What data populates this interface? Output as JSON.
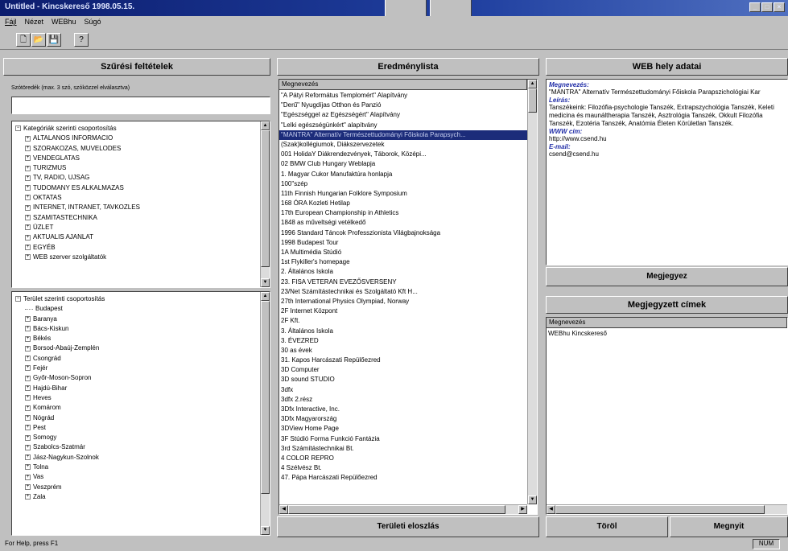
{
  "window": {
    "title": "Untitled - Kincskereső 1998.05.15."
  },
  "menu": [
    "Fájl",
    "Nézet",
    "WEBhu",
    "Súgó"
  ],
  "toolbar": {
    "icons": [
      "new-icon",
      "open-icon",
      "save-icon",
      "help-icon"
    ]
  },
  "filter_panel": {
    "header": "Szűrési feltételek",
    "word_label": "Szótöredék (max. 3 szó, szóközzel elválasztva)",
    "word_value": "",
    "category_root": "Kategóriák szerinti csoportosítás",
    "categories": [
      "ALTALANOS INFORMACIO",
      "SZORAKOZAS, MUVELODES",
      "VENDEGLATAS",
      "TURIZMUS",
      "TV, RADIO, UJSAG",
      "TUDOMANY ES ALKALMAZAS",
      "OKTATAS",
      "INTERNET, INTRANET, TAVKOZLES",
      "SZAMITASTECHNIKA",
      "ÜZLET",
      "AKTUALIS AJANLAT",
      "EGYÉB",
      "WEB szerver szolgáltatók"
    ],
    "region_root": "Terület szerinti csoportosítás",
    "regions": [
      "Budapest",
      "Baranya",
      "Bács-Kiskun",
      "Békés",
      "Borsod-Abaúj-Zemplén",
      "Csongrád",
      "Fejér",
      "Győr-Moson-Sopron",
      "Hajdú-Bihar",
      "Heves",
      "Komárom",
      "Nógrád",
      "Pest",
      "Somogy",
      "Szabolcs-Szatmár",
      "Jász-Nagykun-Szolnok",
      "Tolna",
      "Vas",
      "Veszprém",
      "Zala"
    ]
  },
  "results_panel": {
    "header": "Eredménylista",
    "column": "Megnevezés",
    "rows": [
      "\"A Pátyi Református Templomért\" Alapítvány",
      "\"Derű\" Nyugdíjas Otthon és Panzió",
      "\"Egészséggel az Egészségért\" Alapítvány",
      "\"Lelki egészségünkért\" alapítvány",
      "\"MANTRA\" Alternatív Természettudományi Főiskola Parapsych...",
      "(Szak)kollégiumok, Diákszervezetek",
      "001 HolidaY Diákrendezvények, Táborok, Középi...",
      "02 BMW Club Hungary Weblapja",
      "1. Magyar Cukor Manufaktúra honlapja",
      "100\"szép",
      "11th Finnish Hungarian Folklore Symposium",
      "168 ÓRA Kozleti Hetilap",
      "17th European Championship in Athletics",
      "1848 as műveltségi vetélkedő",
      "1996 Standard Táncok Professzionista Világbajnoksága",
      "1998 Budapest Tour",
      "1A Multimédia Stúdió",
      "1st Flykiller's homepage",
      "2. Általános Iskola",
      "23. FISA VETERAN EVEZŐSVERSENY",
      "23/Net Számítástechnikai és Szolgáltató Kft H...",
      "27th International Physics Olympiad, Norway",
      "2F Internet Központ",
      "2F Kft.",
      "3. Általános Iskola",
      "3. ÉVEZRED",
      "30 as évek",
      "31. Kapos Harcászati Repülőezred",
      "3D Computer",
      "3D sound STUDIO",
      "3dfx",
      "3dfx 2.rész",
      "3Dfx Interactive, Inc.",
      "3Dfx Magyarország",
      "3DView Home Page",
      "3F Stúdió Forma Funkció Fantázia",
      "3rd Számítástechnikai Bt.",
      "4 COLOR REPRO",
      "4 Szélvész Bt.",
      "47. Pápa Harcászati Repülőezred"
    ],
    "selected_index": 4,
    "footer_button": "Területi eloszlás"
  },
  "web_panel": {
    "header": "WEB hely adatai",
    "name_label": "Megnevezés:",
    "name_value": "\"MANTRA\" Alternatív Természettudományi Főiskola Parapszichológiai Kar",
    "desc_label": "Leírás:",
    "desc_value": "Tanszékeink: Filozófia-psychologie Tanszék, Extrapszychológia Tanszék, Keleti medicina és maunáltherapia Tanszék, Asztrológia Tanszék, Okkult Filozófia Tanszék, Ezotéria Tanszék, Anatómia Életen Körületlan Tanszék.",
    "www_label": "WWW cím:",
    "www_value": "http://www.csend.hu",
    "email_label": "E-mail:",
    "email_value": "csend@csend.hu",
    "remember_button": "Megjegyez"
  },
  "saved_panel": {
    "header": "Megjegyzett címek",
    "column": "Megnevezés",
    "rows": [
      "WEBhu Kincskereső"
    ],
    "delete_button": "Töröl",
    "open_button": "Megnyit"
  },
  "statusbar": {
    "text": "For Help, press F1",
    "num": "NUM"
  }
}
